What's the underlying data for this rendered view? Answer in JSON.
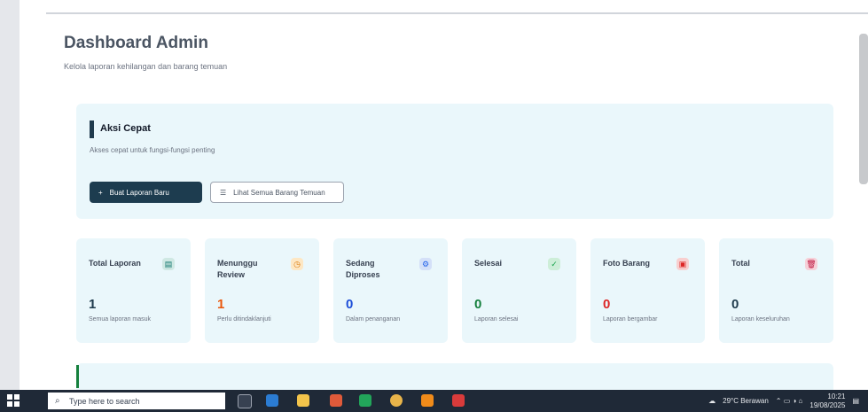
{
  "page": {
    "title": "Dashboard Admin",
    "subtitle": "Kelola laporan kehilangan dan barang temuan"
  },
  "quick_actions": {
    "title": "Aksi Cepat",
    "description": "Akses cepat untuk fungsi-fungsi penting",
    "primary_button": "Buat Laporan Baru",
    "secondary_button": "Lihat Semua Barang Temuan"
  },
  "stats": [
    {
      "label": "Total Laporan",
      "value": "1",
      "description": "Semua laporan masuk",
      "icon": "document-icon",
      "icon_color": "#0f766e",
      "icon_bg": "#cfe8e3",
      "value_color": "#1e3a4c"
    },
    {
      "label": "Menunggu Review",
      "value": "1",
      "description": "Perlu ditindaklanjuti",
      "icon": "clock-icon",
      "icon_color": "#d97706",
      "icon_bg": "#fde7c4",
      "value_color": "#ea580c"
    },
    {
      "label": "Sedang Diproses",
      "value": "0",
      "description": "Dalam penanganan",
      "icon": "gear-icon",
      "icon_color": "#2563eb",
      "icon_bg": "#d4e0f8",
      "value_color": "#1d4ed8"
    },
    {
      "label": "Selesai",
      "value": "0",
      "description": "Laporan selesai",
      "icon": "check-icon",
      "icon_color": "#16a34a",
      "icon_bg": "#cdeed8",
      "value_color": "#15803d"
    },
    {
      "label": "Foto Barang",
      "value": "0",
      "description": "Laporan bergambar",
      "icon": "image-icon",
      "icon_color": "#dc2626",
      "icon_bg": "#f8cfcf",
      "value_color": "#dc2626"
    },
    {
      "label": "Total",
      "value": "0",
      "description": "Laporan keseluruhan",
      "icon": "trash-icon",
      "icon_color": "#be123c",
      "icon_bg": "#f6d0d8",
      "value_color": "#1e3a4c"
    }
  ],
  "taskbar": {
    "search_placeholder": "Type here to search",
    "weather": "29°C Berawan",
    "time": "10:21",
    "date": "19/08/2025"
  },
  "colors": {
    "accent": "#1d3c4f",
    "card_bg": "#eaf7fb"
  }
}
